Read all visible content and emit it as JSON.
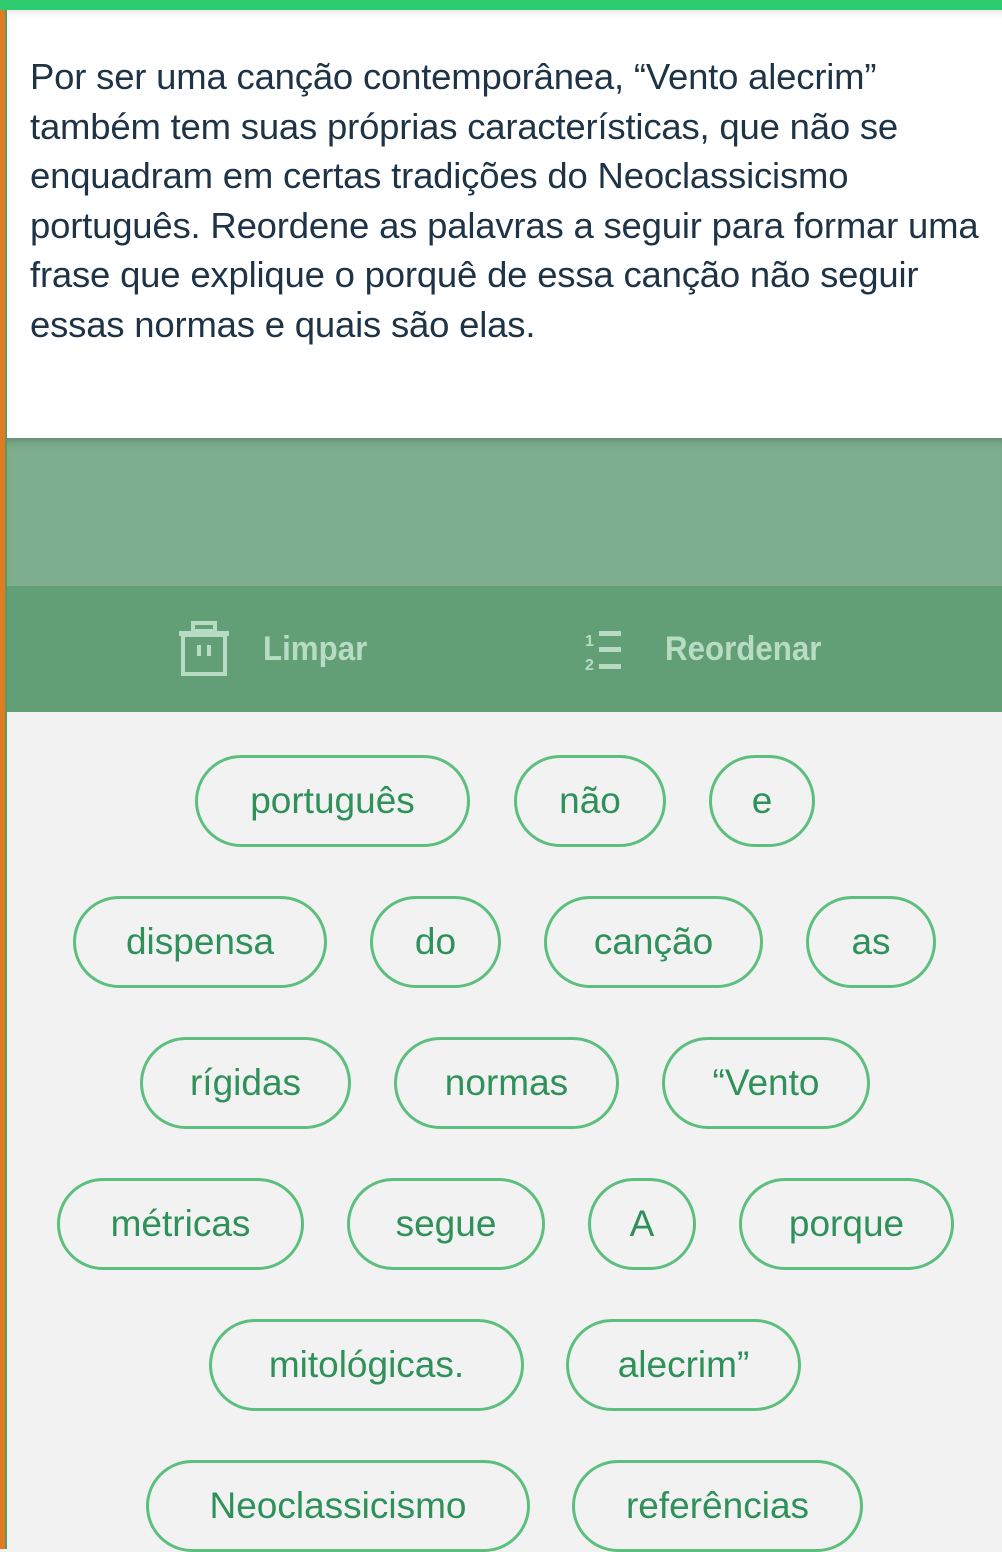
{
  "question": {
    "text": "Por ser uma canção contemporânea, “Vento alecrim” também tem suas próprias características, que não se enquadram em certas tradições do Neoclassicismo português. Reordene as palavras a seguir para formar uma frase que explique o porquê de essa canção não seguir essas normas e quais são elas."
  },
  "answer": {
    "selected_words": []
  },
  "toolbar": {
    "clear_label": "Limpar",
    "clear_icon": "trash-icon",
    "reorder_label": "Reordenar",
    "reorder_icon": "numbered-list-icon"
  },
  "word_bank": [
    "português",
    "não",
    "e",
    "dispensa",
    "do",
    "canção",
    "as",
    "rígidas",
    "normas",
    "“Vento",
    "métricas",
    "segue",
    "A",
    "porque",
    "mitológicas.",
    "alecrim”",
    "Neoclassicismo",
    "referências"
  ],
  "colors": {
    "top_accent": "#2ecc71",
    "left_accent": "#e07b24",
    "answer_area": "#7daf8e",
    "toolbar": "#629f76",
    "toolbar_text": "#b8dcc3",
    "chip_border": "#5cbf7d",
    "chip_text": "#2e9159",
    "question_text": "#1e3346"
  }
}
